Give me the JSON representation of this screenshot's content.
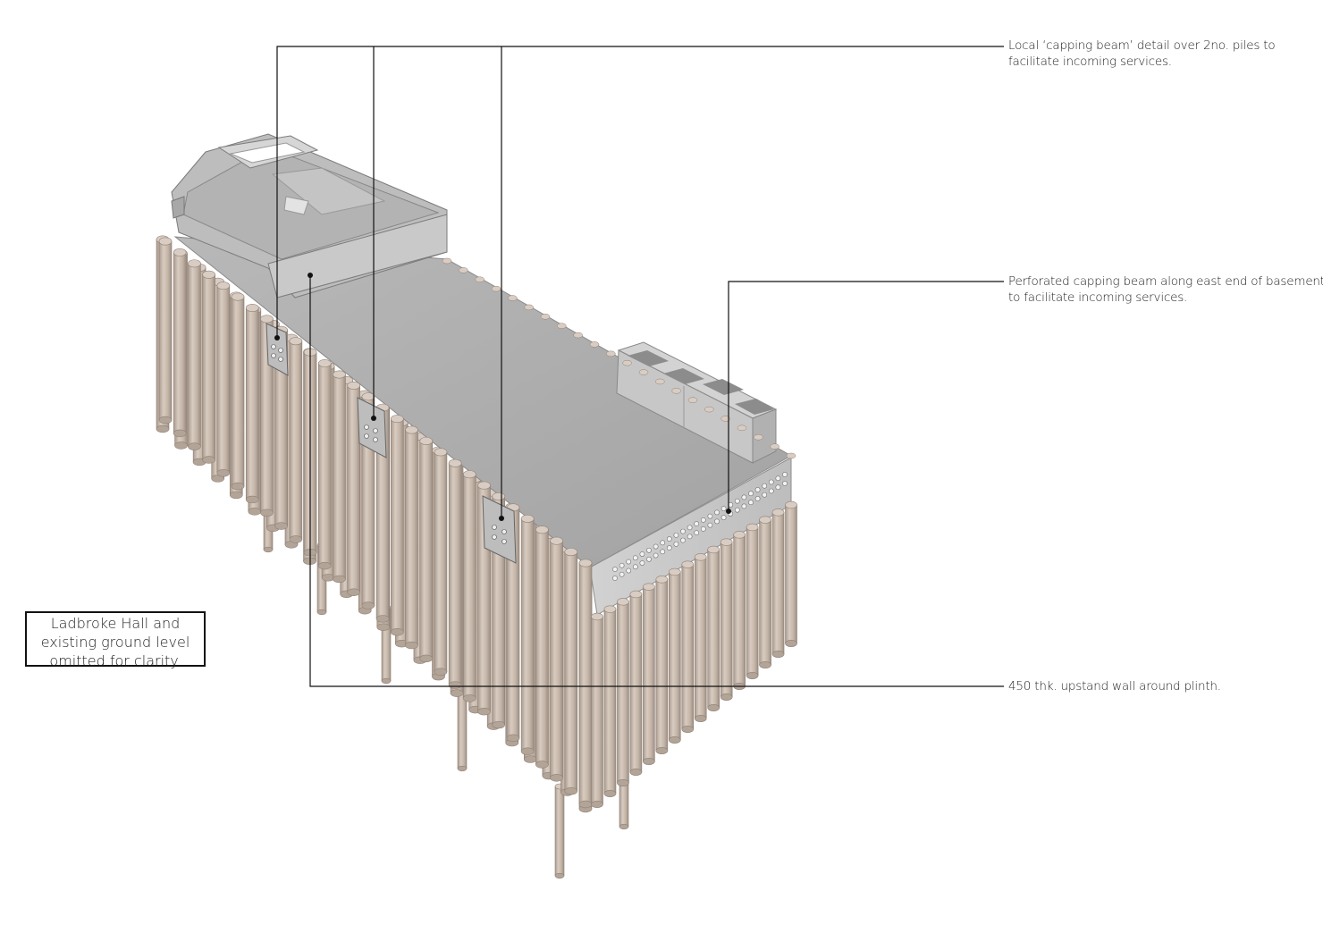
{
  "annotations": {
    "capping_beam_detail": [
      "Local ‘capping beam’ detail over 2no. piles to",
      "facilitate incoming services."
    ],
    "perforated_beam": [
      "Perforated capping beam along east end of basement",
      "to facilitate incoming services."
    ],
    "upstand_wall": [
      "450 thk. upstand wall around plinth."
    ]
  },
  "note": [
    "Ladbroke Hall and",
    "existing ground level",
    "omitted for clarity."
  ],
  "colors": {
    "pile": "#cbbcaf",
    "pile_shade": "#a8998d",
    "slab": "#a9a9a9",
    "beam_face": "#c9c9c9",
    "leader_line": "#111111"
  }
}
